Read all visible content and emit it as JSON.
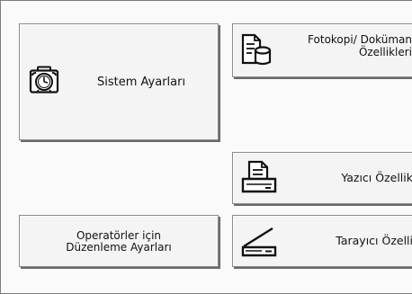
{
  "buttons": {
    "system": {
      "label": "Sistem Ayarları",
      "icon": "alarm-clock-briefcase-icon"
    },
    "copy": {
      "label_line1": "Fotokopi/ Doküman",
      "label_line2": "Özellikleri",
      "icon": "copier-document-server-icon"
    },
    "printer": {
      "label": "Yazıcı Özellik",
      "icon": "printer-icon"
    },
    "operator": {
      "label_line1": "Operatörler için",
      "label_line2": "Düzenleme Ayarları"
    },
    "scanner": {
      "label": "Tarayıcı Özelli",
      "icon": "scanner-icon"
    }
  }
}
